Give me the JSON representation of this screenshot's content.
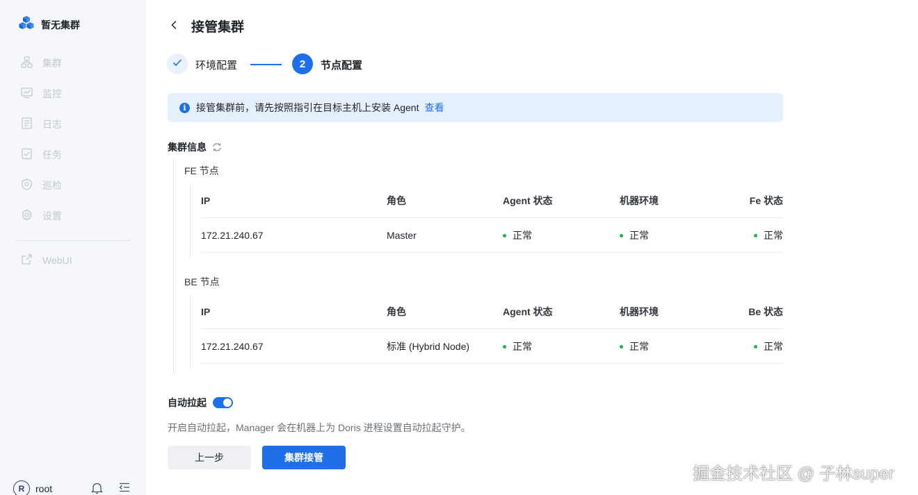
{
  "brand": {
    "title": "暂无集群",
    "icon": "cubes-logo-icon"
  },
  "sidebar": {
    "items": [
      {
        "label": "集群",
        "icon": "cluster-icon"
      },
      {
        "label": "监控",
        "icon": "monitor-icon"
      },
      {
        "label": "日志",
        "icon": "log-icon"
      },
      {
        "label": "任务",
        "icon": "task-icon"
      },
      {
        "label": "巡检",
        "icon": "inspect-icon"
      },
      {
        "label": "设置",
        "icon": "gear-icon"
      }
    ],
    "extra_item": {
      "label": "WebUI",
      "icon": "external-link-icon"
    },
    "user": {
      "avatar_letter": "R",
      "name": "root"
    }
  },
  "header": {
    "title": "接管集群"
  },
  "steps": [
    {
      "label": "环境配置",
      "state": "done"
    },
    {
      "number": "2",
      "label": "节点配置",
      "state": "active"
    }
  ],
  "alert": {
    "icon_letter": "i",
    "text": "接管集群前，请先按照指引在目标主机上安装 Agent",
    "link": "查看"
  },
  "cluster_info": {
    "title": "集群信息",
    "fe": {
      "label": "FE 节点",
      "headers": [
        "IP",
        "角色",
        "Agent 状态",
        "机器环境",
        "Fe 状态"
      ],
      "rows": [
        {
          "ip": "172.21.240.67",
          "role": "Master",
          "agent": "正常",
          "env": "正常",
          "state": "正常"
        }
      ]
    },
    "be": {
      "label": "BE 节点",
      "headers": [
        "IP",
        "角色",
        "Agent 状态",
        "机器环境",
        "Be 状态"
      ],
      "rows": [
        {
          "ip": "172.21.240.67",
          "role": "标准 (Hybrid Node)",
          "agent": "正常",
          "env": "正常",
          "state": "正常"
        }
      ]
    }
  },
  "auto_restart": {
    "label": "自动拉起",
    "enabled": true,
    "description": "开启自动拉起，Manager 会在机器上为 Doris 进程设置自动拉起守护。"
  },
  "buttons": {
    "prev": "上一步",
    "submit": "集群接管"
  },
  "watermark": "掘金技术社区 @ 子林super",
  "colors": {
    "primary": "#1f6fea",
    "success": "#22b14c",
    "sidebar_bg": "#f5f7fa",
    "alert_bg": "#e6f0fc"
  }
}
